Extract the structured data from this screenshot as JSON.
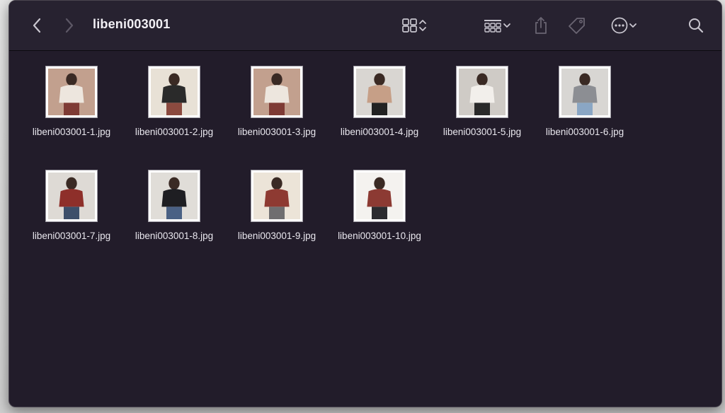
{
  "window": {
    "title": "libeni003001"
  },
  "toolbar": {
    "back_icon": "chevron-left-icon",
    "forward_icon": "chevron-right-icon",
    "view_icon": "grid-view-icon",
    "group_icon": "group-icon",
    "share_icon": "share-icon",
    "tag_icon": "tag-icon",
    "more_icon": "more-icon",
    "search_icon": "search-icon"
  },
  "files": [
    {
      "name": "libeni003001-1.jpg",
      "palette": [
        "#c2a08e",
        "#ede6de",
        "#7e3b35"
      ]
    },
    {
      "name": "libeni003001-2.jpg",
      "palette": [
        "#e8e1d6",
        "#2a2a2a",
        "#8b4a3f"
      ]
    },
    {
      "name": "libeni003001-3.jpg",
      "palette": [
        "#c2a08e",
        "#ede6de",
        "#7e3b35"
      ]
    },
    {
      "name": "libeni003001-4.jpg",
      "palette": [
        "#d9d6d2",
        "#c69f87",
        "#222222"
      ]
    },
    {
      "name": "libeni003001-5.jpg",
      "palette": [
        "#cfcbc6",
        "#f2efeb",
        "#2a2a2a"
      ]
    },
    {
      "name": "libeni003001-6.jpg",
      "palette": [
        "#d8d6d3",
        "#8c8e93",
        "#8aa6c4"
      ]
    },
    {
      "name": "libeni003001-7.jpg",
      "palette": [
        "#dedad5",
        "#8e2f2a",
        "#3d4f6a"
      ]
    },
    {
      "name": "libeni003001-8.jpg",
      "palette": [
        "#e0ddd8",
        "#1e1e22",
        "#4a6184"
      ]
    },
    {
      "name": "libeni003001-9.jpg",
      "palette": [
        "#ece4d8",
        "#8e3a32",
        "#6f6e70"
      ]
    },
    {
      "name": "libeni003001-10.jpg",
      "palette": [
        "#f4f2ef",
        "#8c3a33",
        "#2c2c30"
      ]
    }
  ]
}
